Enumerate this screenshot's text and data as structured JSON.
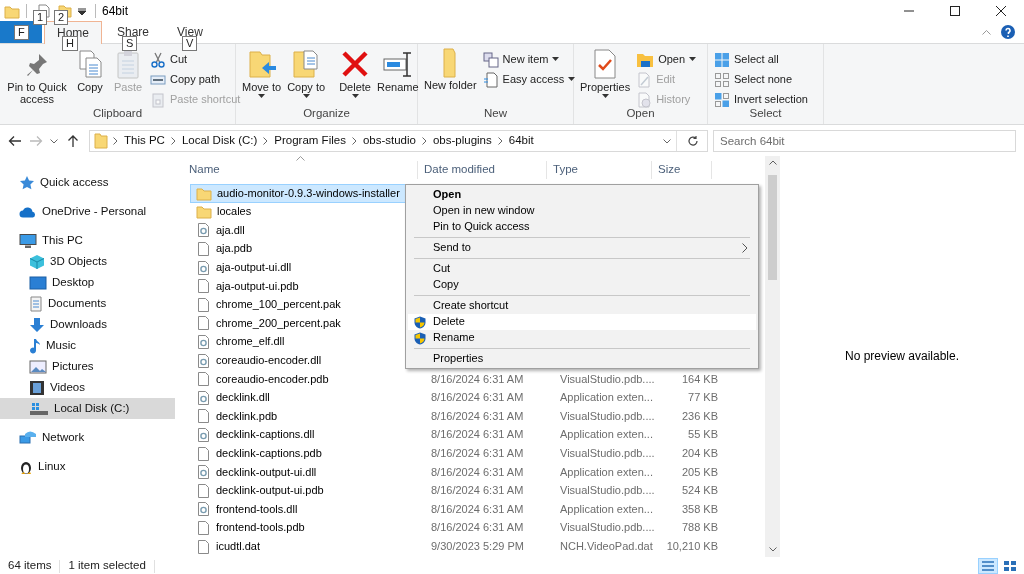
{
  "window": {
    "title": "64bit",
    "quick_access_keytips": [
      "1",
      "2"
    ]
  },
  "tabs": [
    {
      "kind": "file",
      "keytip": "F",
      "selected": false
    },
    {
      "label": "Home",
      "kind": "tab",
      "keytip": "H",
      "selected": true
    },
    {
      "label": "Share",
      "kind": "tab",
      "keytip": "S",
      "selected": false
    },
    {
      "label": "View",
      "kind": "tab",
      "keytip": "V",
      "selected": false
    }
  ],
  "ribbon": {
    "groups": [
      {
        "label": "Clipboard",
        "large": [
          {
            "label": "Pin to Quick access",
            "kind": "pin",
            "disabled": false,
            "dropdown": false
          },
          {
            "label": "Copy",
            "kind": "copy",
            "disabled": false,
            "dropdown": false
          },
          {
            "label": "Paste",
            "kind": "paste",
            "disabled": true,
            "dropdown": false
          }
        ],
        "small": [
          {
            "label": "Cut",
            "kind": "cut",
            "disabled": false,
            "dropdown": false
          },
          {
            "label": "Copy path",
            "kind": "copypath",
            "disabled": false,
            "dropdown": false
          },
          {
            "label": "Paste shortcut",
            "kind": "pasteshortcut",
            "disabled": true,
            "dropdown": false
          }
        ]
      },
      {
        "label": "Organize",
        "large": [
          {
            "label": "Move to",
            "kind": "moveto",
            "disabled": false,
            "dropdown": true
          },
          {
            "label": "Copy to",
            "kind": "copyto",
            "disabled": false,
            "dropdown": true
          },
          {
            "label": "Delete",
            "kind": "delete",
            "disabled": false,
            "dropdown": true
          },
          {
            "label": "Rename",
            "kind": "rename",
            "disabled": false,
            "dropdown": false
          }
        ]
      },
      {
        "label": "New",
        "large": [
          {
            "label": "New folder",
            "kind": "newfolder",
            "disabled": false,
            "dropdown": false
          }
        ],
        "small": [
          {
            "label": "New item",
            "kind": "newitem",
            "disabled": false,
            "dropdown": true
          },
          {
            "label": "Easy access",
            "kind": "easyaccess",
            "disabled": false,
            "dropdown": true
          }
        ]
      },
      {
        "label": "Open",
        "large": [
          {
            "label": "Properties",
            "kind": "properties",
            "disabled": false,
            "dropdown": true
          }
        ],
        "small": [
          {
            "label": "Open",
            "kind": "open",
            "disabled": false,
            "dropdown": true
          },
          {
            "label": "Edit",
            "kind": "edit",
            "disabled": true,
            "dropdown": false
          },
          {
            "label": "History",
            "kind": "history",
            "disabled": true,
            "dropdown": false
          }
        ]
      },
      {
        "label": "Select",
        "small": [
          {
            "label": "Select all",
            "kind": "selectall",
            "disabled": false,
            "dropdown": false
          },
          {
            "label": "Select none",
            "kind": "selectnone",
            "disabled": false,
            "dropdown": false
          },
          {
            "label": "Invert selection",
            "kind": "invert",
            "disabled": false,
            "dropdown": false
          }
        ]
      }
    ]
  },
  "address_bar": {
    "path": [
      "This PC",
      "Local Disk (C:)",
      "Program Files",
      "obs-studio",
      "obs-plugins",
      "64bit"
    ],
    "search_placeholder": "Search 64bit"
  },
  "navigation": [
    {
      "label": "Quick access",
      "kind": "star",
      "selected": false
    },
    {
      "label": "OneDrive - Personal",
      "kind": "cloud",
      "selected": false
    },
    {
      "label": "This PC",
      "kind": "pc",
      "selected": false,
      "children": [
        {
          "label": "3D Objects",
          "kind": "cube",
          "selected": false
        },
        {
          "label": "Desktop",
          "kind": "desktop",
          "selected": false
        },
        {
          "label": "Documents",
          "kind": "documents",
          "selected": false
        },
        {
          "label": "Downloads",
          "kind": "downloads",
          "selected": false
        },
        {
          "label": "Music",
          "kind": "music",
          "selected": false
        },
        {
          "label": "Pictures",
          "kind": "pictures",
          "selected": false
        },
        {
          "label": "Videos",
          "kind": "videos",
          "selected": false
        },
        {
          "label": "Local Disk (C:)",
          "kind": "drive",
          "selected": true
        }
      ]
    },
    {
      "label": "Network",
      "kind": "network",
      "selected": false
    },
    {
      "label": "Linux",
      "kind": "penguin",
      "selected": false
    }
  ],
  "file_list": {
    "columns": [
      "Name",
      "Date modified",
      "Type",
      "Size"
    ],
    "rows": [
      {
        "name": "audio-monitor-0.9.3-windows-installer",
        "kind": "folder",
        "selected": true
      },
      {
        "name": "locales",
        "kind": "folder",
        "selected": false
      },
      {
        "name": "aja.dll",
        "kind": "dll",
        "selected": false
      },
      {
        "name": "aja.pdb",
        "kind": "file",
        "selected": false
      },
      {
        "name": "aja-output-ui.dll",
        "kind": "dll",
        "selected": false
      },
      {
        "name": "aja-output-ui.pdb",
        "kind": "file",
        "selected": false
      },
      {
        "name": "chrome_100_percent.pak",
        "kind": "file",
        "selected": false
      },
      {
        "name": "chrome_200_percent.pak",
        "kind": "file",
        "selected": false
      },
      {
        "name": "chrome_elf.dll",
        "kind": "dll",
        "selected": false
      },
      {
        "name": "coreaudio-encoder.dll",
        "kind": "dll",
        "selected": false
      },
      {
        "name": "coreaudio-encoder.pdb",
        "kind": "file",
        "selected": false,
        "date": "8/16/2024 6:31 AM",
        "type": "VisualStudio.pdb....",
        "size": "164 KB"
      },
      {
        "name": "decklink.dll",
        "kind": "dll",
        "selected": false,
        "date": "8/16/2024 6:31 AM",
        "type": "Application exten...",
        "size": "77 KB"
      },
      {
        "name": "decklink.pdb",
        "kind": "file",
        "selected": false,
        "date": "8/16/2024 6:31 AM",
        "type": "VisualStudio.pdb....",
        "size": "236 KB"
      },
      {
        "name": "decklink-captions.dll",
        "kind": "dll",
        "selected": false,
        "date": "8/16/2024 6:31 AM",
        "type": "Application exten...",
        "size": "55 KB"
      },
      {
        "name": "decklink-captions.pdb",
        "kind": "file",
        "selected": false,
        "date": "8/16/2024 6:31 AM",
        "type": "VisualStudio.pdb....",
        "size": "204 KB"
      },
      {
        "name": "decklink-output-ui.dll",
        "kind": "dll",
        "selected": false,
        "date": "8/16/2024 6:31 AM",
        "type": "Application exten...",
        "size": "205 KB"
      },
      {
        "name": "decklink-output-ui.pdb",
        "kind": "file",
        "selected": false,
        "date": "8/16/2024 6:31 AM",
        "type": "VisualStudio.pdb....",
        "size": "524 KB"
      },
      {
        "name": "frontend-tools.dll",
        "kind": "dll",
        "selected": false,
        "date": "8/16/2024 6:31 AM",
        "type": "Application exten...",
        "size": "358 KB"
      },
      {
        "name": "frontend-tools.pdb",
        "kind": "file",
        "selected": false,
        "date": "8/16/2024 6:31 AM",
        "type": "VisualStudio.pdb....",
        "size": "788 KB"
      },
      {
        "name": "icudtl.dat",
        "kind": "file",
        "selected": false,
        "date": "9/30/2023 5:29 PM",
        "type": "NCH.VideoPad.dat",
        "size": "10,210 KB"
      }
    ]
  },
  "context_menu": {
    "groups": [
      [
        {
          "label": "Open",
          "kind": "default",
          "selected": false
        },
        {
          "label": "Open in new window",
          "kind": "plain",
          "selected": false
        },
        {
          "label": "Pin to Quick access",
          "kind": "plain",
          "selected": false
        }
      ],
      [
        {
          "label": "Send to",
          "kind": "submenu",
          "selected": false
        }
      ],
      [
        {
          "label": "Cut",
          "kind": "plain",
          "selected": false
        },
        {
          "label": "Copy",
          "kind": "plain",
          "selected": false
        }
      ],
      [
        {
          "label": "Create shortcut",
          "kind": "plain",
          "selected": false
        },
        {
          "label": "Delete",
          "kind": "admin",
          "selected": true
        },
        {
          "label": "Rename",
          "kind": "admin",
          "selected": false
        }
      ],
      [
        {
          "label": "Properties",
          "kind": "plain",
          "selected": false
        }
      ]
    ]
  },
  "preview": {
    "message": "No preview available."
  },
  "status_bar": {
    "item_count": "64 items",
    "selection": "1 item selected",
    "views": [
      {
        "kind": "details",
        "selected": true
      },
      {
        "kind": "tiles",
        "selected": false
      }
    ]
  }
}
